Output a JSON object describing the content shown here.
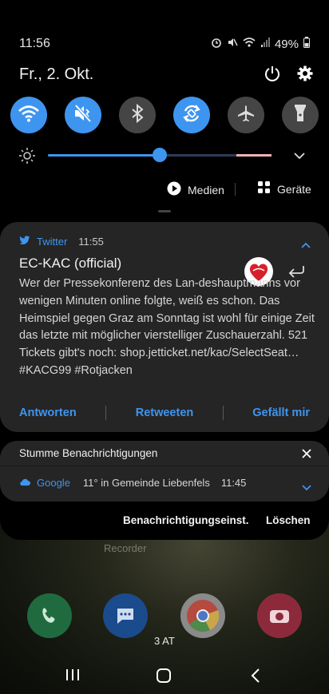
{
  "status_bar": {
    "time": "11:56",
    "battery": "49%"
  },
  "date": "Fr., 2. Okt.",
  "quick_toggles": [
    {
      "name": "wifi",
      "state": "on"
    },
    {
      "name": "sound-mute",
      "state": "on"
    },
    {
      "name": "bluetooth",
      "state": "off"
    },
    {
      "name": "auto-rotate",
      "state": "on"
    },
    {
      "name": "airplane-mode",
      "state": "off"
    },
    {
      "name": "flashlight",
      "state": "off"
    }
  ],
  "brightness_level": 0.5,
  "media_row": {
    "media_label": "Medien",
    "devices_label": "Geräte"
  },
  "twitter_notification": {
    "app_name": "Twitter",
    "time": "11:55",
    "title": "EC-KAC (official)",
    "body": "Wer der Pressekonferenz des Lan-deshauptmanns vor wenigen Minuten online folgte, weiß es schon. Das Heimspiel gegen Graz am Sonntag ist wohl für einige Zeit das letzte mit möglicher vierstelliger Zuschauerzahl. 521 Tickets gibt's noch: shop.jetticket.net/kac/SelectSeat… #KACG99 #Rotjacken",
    "actions": {
      "reply": "Antworten",
      "retweet": "Retweeten",
      "like": "Gefällt mir"
    }
  },
  "silent_notifications": {
    "header": "Stumme Benachrichtigungen",
    "google": {
      "app_name": "Google",
      "text": "11° in Gemeinde Liebenfels",
      "time": "11:45"
    }
  },
  "bottom_buttons": {
    "settings": "Benachrichtigungseinst.",
    "clear": "Löschen"
  },
  "home": {
    "recorder_label": "Recorder",
    "carrier": "3 AT"
  },
  "colors": {
    "accent": "#3e95f0",
    "card": "#252525",
    "toggle_off": "#454545"
  }
}
